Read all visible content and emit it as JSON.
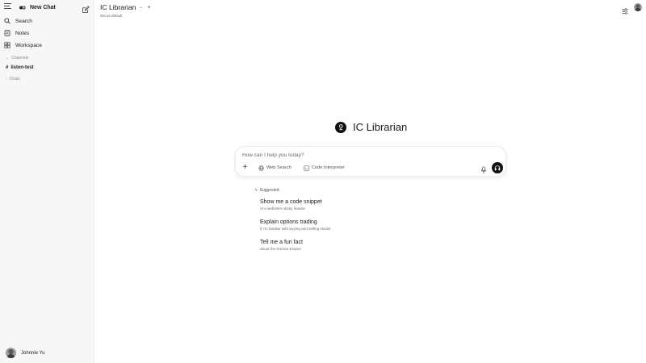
{
  "sidebar": {
    "brand": "New Chat",
    "nav": [
      {
        "label": "Search",
        "icon": "search-icon"
      },
      {
        "label": "Notes",
        "icon": "notes-icon"
      },
      {
        "label": "Workspace",
        "icon": "workspace-icon"
      }
    ],
    "channels_label": "Channels",
    "channel_name": "listen-test",
    "chats_label": "Chats",
    "user_name": "Johnnie Yu"
  },
  "header": {
    "model_name": "IC Librarian",
    "set_default": "Set as default"
  },
  "main": {
    "title": "IC Librarian",
    "composer": {
      "placeholder": "How can I help you today?",
      "web_search": "Web Search",
      "code_interpreter": "Code Interpreter"
    },
    "suggested_label": "Suggested",
    "suggestions": [
      {
        "title": "Show me a code snippet",
        "subtitle": "of a website's sticky header"
      },
      {
        "title": "Explain options trading",
        "subtitle": "if I'm familiar with buying and selling stocks"
      },
      {
        "title": "Tell me a fun fact",
        "subtitle": "about the Roman Empire"
      }
    ]
  },
  "colors": {
    "sidebar_bg": "#f7f7f7",
    "accent": "#111111"
  }
}
